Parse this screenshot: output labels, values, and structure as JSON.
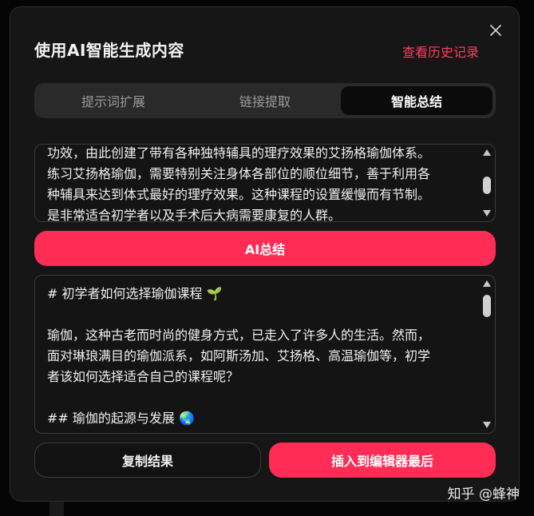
{
  "dialog": {
    "title": "使用AI智能生成内容",
    "history_link": "查看历史记录",
    "close_icon": "close-icon"
  },
  "tabs": [
    {
      "label": "提示词扩展",
      "active": false
    },
    {
      "label": "链接提取",
      "active": false
    },
    {
      "label": "智能总结",
      "active": true
    }
  ],
  "source_text": "功效，由此创建了带有各种独特辅具的理疗效果的艾扬格瑜伽体系。\n练习艾扬格瑜伽，需要特别关注身体各部位的顺位细节，善于利用各\n种辅具来达到体式最好的理疗效果。这种课程的设置缓慢而有节制。\n是非常适合初学者以及手术后大病需要康复的人群。",
  "ai_button": "AI总结",
  "result_text": "# 初学者如何选择瑜伽课程 🌱\n\n瑜伽，这种古老而时尚的健身方式，已走入了许多人的生活。然而，\n面对琳琅满目的瑜伽派系，如阿斯汤加、艾扬格、高温瑜伽等，初学\n者该如何选择适合自己的课程呢？\n\n## 瑜伽的起源与发展 🌏",
  "actions": {
    "copy": "复制结果",
    "insert": "插入到编辑器最后"
  },
  "watermark": "知乎 @蜂神",
  "colors": {
    "accent": "#ff2d55",
    "link": "#ff3b5f",
    "dialog_bg": "#161616"
  }
}
